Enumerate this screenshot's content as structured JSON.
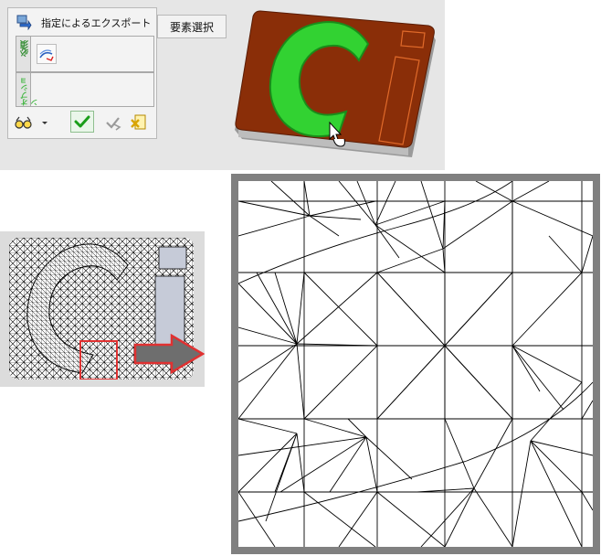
{
  "dialog": {
    "title": "指定によるエクスポート",
    "section_required_label": "必須",
    "section_options_label": "オプション"
  },
  "selection_button": {
    "label": "要素選択"
  },
  "icons": {
    "title": "export-arrow-icon",
    "surface_tool": "surface-select-icon",
    "preview": "glasses-icon",
    "dropdown": "chevron-down-icon",
    "ok": "checkmark-icon",
    "apply": "apply-arrow-icon",
    "cancel": "cancel-x-icon",
    "arrow": "red-outlined-arrow-icon"
  },
  "colors": {
    "required_tab": "#4caf50",
    "options_tab": "#4caf50",
    "ok_check": "#1a9e1a",
    "model_body": "#8a2e08",
    "model_highlight": "#32d232",
    "callout_red": "#e03131",
    "frame_gray": "#808080"
  }
}
